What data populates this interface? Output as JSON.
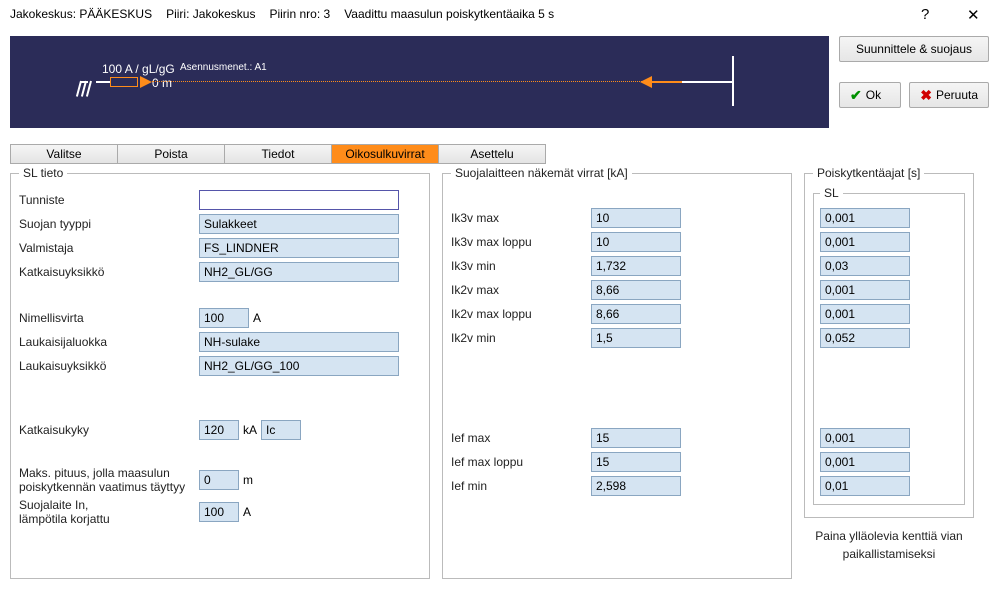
{
  "title": {
    "jakokeskus_label": "Jakokeskus:",
    "jakokeskus": "PÄÄKESKUS",
    "piiri_label": "Piiri:",
    "piiri": "Jakokeskus",
    "piirinro_label": "Piirin nro:",
    "piirinro": "3",
    "vaadittu_label": "Vaadittu maasulun poiskytkentäaika",
    "vaadittu": "5 s"
  },
  "buttons": {
    "suunnittele": "Suunnittele & suojaus",
    "ok": "Ok",
    "peruuta": "Peruuta"
  },
  "diagram": {
    "line1": "100 A / gL/gG",
    "line2": "0 m",
    "line3": "Asennusmenet.: A1"
  },
  "tabs": {
    "valitse": "Valitse",
    "poista": "Poista",
    "tiedot": "Tiedot",
    "oikosulkuvirrat": "Oikosulkuvirrat",
    "asettelu": "Asettelu"
  },
  "sl": {
    "legend": "SL tieto",
    "tunniste": "Tunniste",
    "tunniste_val": "",
    "suojan_tyyppi": "Suojan tyyppi",
    "suojan_tyyppi_val": "Sulakkeet",
    "valmistaja": "Valmistaja",
    "valmistaja_val": "FS_LINDNER",
    "katkaisuyksikko": "Katkaisuyksikkö",
    "katkaisuyksikko_val": "NH2_GL/GG",
    "nimellisvirta": "Nimellisvirta",
    "nimellisvirta_val": "100",
    "nimellisvirta_unit": "A",
    "laukaisuluokka": "Laukaisijaluokka",
    "laukaisuluokka_val": "NH-sulake",
    "laukaisuyksikko": "Laukaisuyksikkö",
    "laukaisuyksikko_val": "NH2_GL/GG_100",
    "katkaisukyky": "Katkaisukyky",
    "katkaisukyky_val": "120",
    "katkaisukyky_unit": "kA",
    "katkaisukyky_field": "Ic",
    "maks_label1": "Maks. pituus, jolla maasulun",
    "maks_label2": "poiskytkennän vaatimus täyttyy",
    "maks_val": "0",
    "maks_unit": "m",
    "suojalaite_label1": "Suojalaite In,",
    "suojalaite_label2": "lämpötila korjattu",
    "suojalaite_val": "100",
    "suojalaite_unit": "A"
  },
  "virrat": {
    "legend": "Suojalaitteen näkemät virrat [kA]",
    "rows": [
      {
        "label": "Ik3v max",
        "val": "10"
      },
      {
        "label": "Ik3v max loppu",
        "val": "10"
      },
      {
        "label": "Ik3v min",
        "val": "1,732"
      },
      {
        "label": "Ik2v max",
        "val": "8,66"
      },
      {
        "label": "Ik2v max loppu",
        "val": "8,66"
      },
      {
        "label": "Ik2v min",
        "val": "1,5"
      }
    ],
    "rows2": [
      {
        "label": "Ief max",
        "val": "15"
      },
      {
        "label": "Ief max loppu",
        "val": "15"
      },
      {
        "label": "Ief min",
        "val": "2,598"
      }
    ]
  },
  "ajat": {
    "legend": "Poiskytkentäajat [s]",
    "sl_legend": "SL",
    "vals": [
      "0,001",
      "0,001",
      "0,03",
      "0,001",
      "0,001",
      "0,052"
    ],
    "vals2": [
      "0,001",
      "0,001",
      "0,01"
    ]
  },
  "hint": {
    "line1": "Paina ylläolevia kenttiä vian",
    "line2": "paikallistamiseksi"
  }
}
